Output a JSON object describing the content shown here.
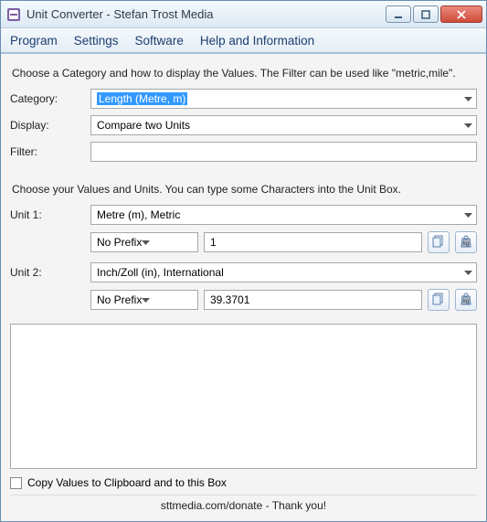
{
  "window": {
    "title": "Unit Converter - Stefan Trost Media"
  },
  "menu": {
    "program": "Program",
    "settings": "Settings",
    "software": "Software",
    "help": "Help and Information"
  },
  "section1": {
    "hint": "Choose a Category and how to display the Values. The Filter can be used like \"metric,mile\".",
    "category_label": "Category:",
    "category_value": "Length (Metre, m)",
    "display_label": "Display:",
    "display_value": "Compare two Units",
    "filter_label": "Filter:",
    "filter_value": ""
  },
  "section2": {
    "hint": "Choose your Values and Units. You can type some Characters into the Unit Box.",
    "unit1_label": "Unit 1:",
    "unit1_value": "Metre (m), Metric",
    "unit1_prefix": "No Prefix",
    "unit1_amount": "1",
    "unit2_label": "Unit 2:",
    "unit2_value": "Inch/Zoll (in), International",
    "unit2_prefix": "No Prefix",
    "unit2_amount": "39.3701"
  },
  "checkbox": {
    "label": "Copy Values to Clipboard and to this Box"
  },
  "footer": {
    "text": "sttmedia.com/donate - Thank you!"
  }
}
